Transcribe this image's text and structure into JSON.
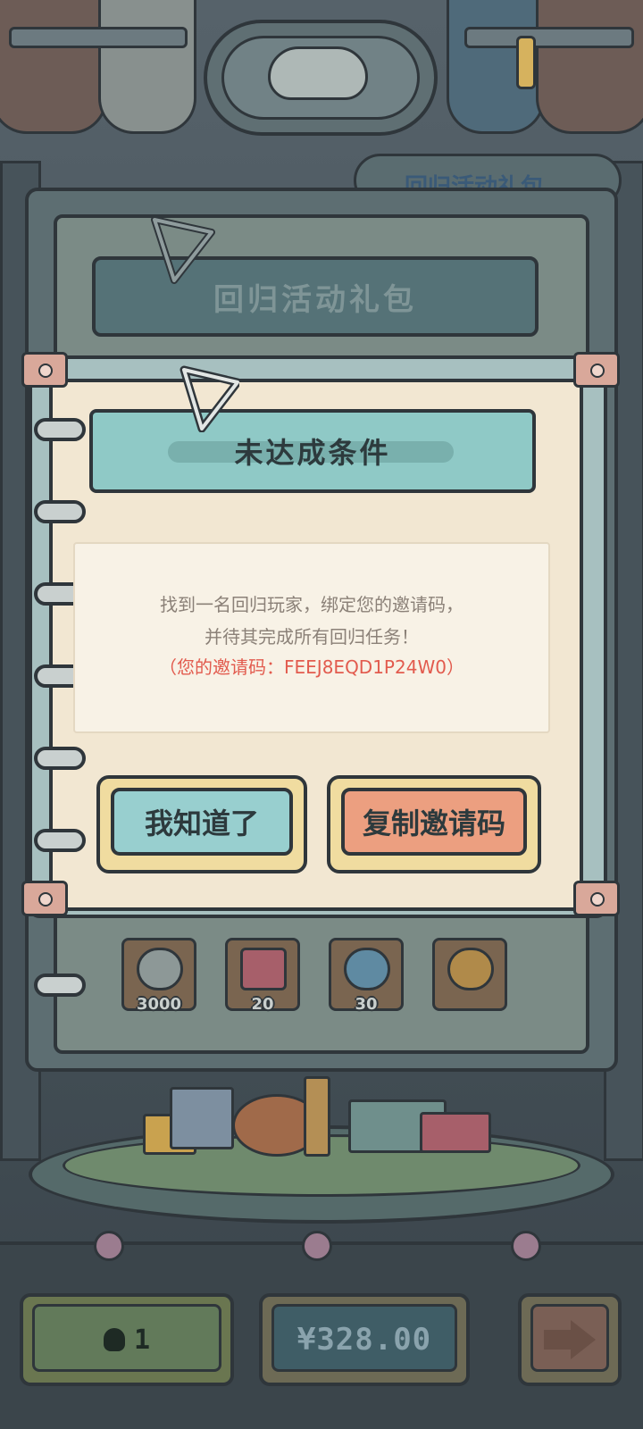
{
  "background": {
    "header_title": "回归活动礼包",
    "side_bubble_text": "回归活动礼包",
    "rewards": [
      {
        "icon": "ghost-icon",
        "qty": "3000"
      },
      {
        "icon": "ticket-icon",
        "qty": "20"
      },
      {
        "icon": "potion-icon",
        "qty": "30"
      },
      {
        "icon": "ring-icon",
        "qty": ""
      }
    ]
  },
  "dialog": {
    "title": "未达成条件",
    "line1": "找到一名回归玩家，绑定您的邀请码，",
    "line2": "并待其完成所有回归任务！",
    "invite_line": "（您的邀请码：FEEJ8EQD1P24W0）",
    "ok_label": "我知道了",
    "copy_label": "复制邀请码"
  },
  "bottom_bar": {
    "count": "1",
    "price": "¥328.00",
    "next_icon": "arrow-right-icon"
  },
  "colors": {
    "accent_teal": "#8fc9c6",
    "accent_orange": "#ec9f80",
    "invite_red": "#e25b4e"
  }
}
